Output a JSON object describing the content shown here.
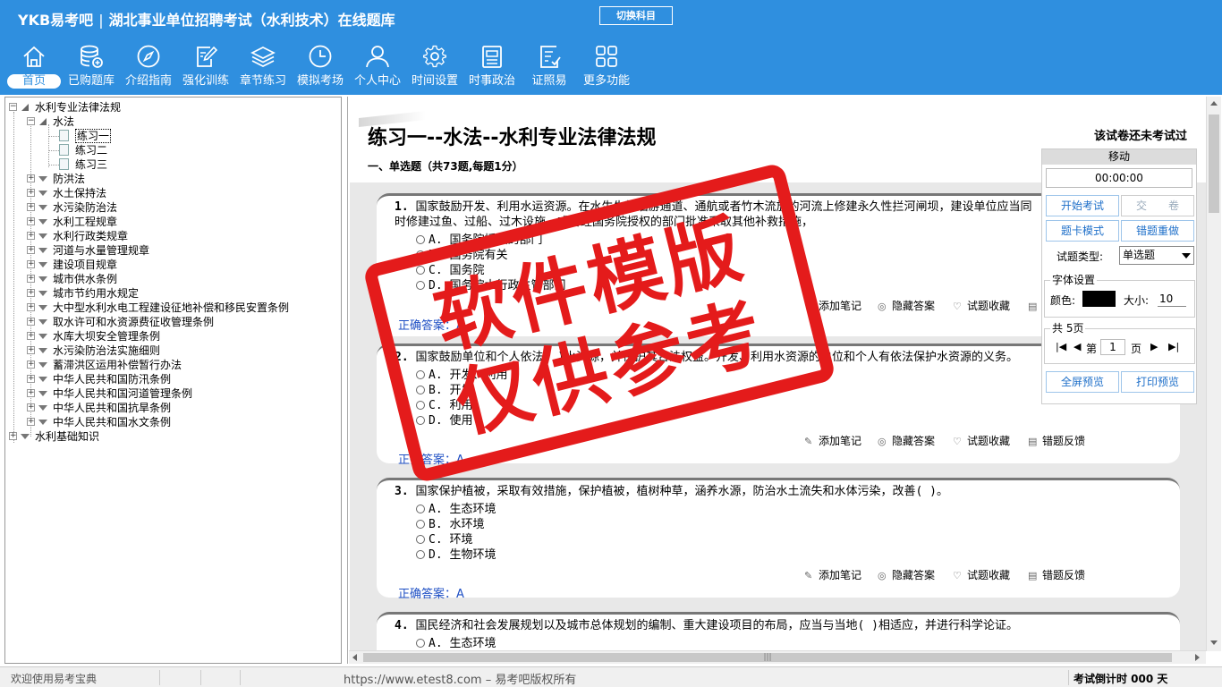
{
  "app": {
    "logo": "YKB易考吧",
    "separator": "|",
    "title": "湖北事业单位招聘考试（水利技术）在线题库",
    "switch_subject": "切换科目"
  },
  "nav": [
    {
      "label": "首页",
      "icon": "home-icon",
      "active": true
    },
    {
      "label": "已购题库",
      "icon": "database-icon"
    },
    {
      "label": "介绍指南",
      "icon": "compass-icon"
    },
    {
      "label": "强化训练",
      "icon": "edit-icon"
    },
    {
      "label": "章节练习",
      "icon": "layers-icon"
    },
    {
      "label": "模拟考场",
      "icon": "clock-icon"
    },
    {
      "label": "个人中心",
      "icon": "user-icon"
    },
    {
      "label": "时间设置",
      "icon": "gear-icon"
    },
    {
      "label": "时事政治",
      "icon": "newspaper-icon"
    },
    {
      "label": "证照易",
      "icon": "checklist-icon"
    },
    {
      "label": "更多功能",
      "icon": "grid-icon"
    }
  ],
  "tree": {
    "root": "水利专业法律法规",
    "open_child": "水法",
    "leaves": [
      "练习一",
      "练习二",
      "练习三"
    ],
    "siblings": [
      "防洪法",
      "水土保持法",
      "水污染防治法",
      "水利工程规章",
      "水利行政类规章",
      "河道与水量管理规章",
      "建设项目规章",
      "城市供水条例",
      "城市节约用水规定",
      "大中型水利水电工程建设征地补偿和移民安置条例",
      "取水许可和水资源费征收管理条例",
      "水库大坝安全管理条例",
      "水污染防治法实施细则",
      "蓄滞洪区运用补偿暂行办法",
      "中华人民共和国防汛条例",
      "中华人民共和国河道管理条例",
      "中华人民共和国抗旱条例",
      "中华人民共和国水文条例"
    ],
    "root2": "水利基础知识"
  },
  "paper": {
    "title": "练习一--水法--水利专业法律法规",
    "status": "该试卷还未考试过",
    "section": "一、单选题（共73题,每题1分）"
  },
  "tools": {
    "note": "添加笔记",
    "hide": "隐藏答案",
    "fav": "试题收藏",
    "report": "错题反馈"
  },
  "answer_label": "正确答案：",
  "questions": [
    {
      "num": "1.",
      "text": "国家鼓励开发、利用水运资源。在水生生物洄游通道、通航或者竹木流放的河流上修建永久性拦河闸坝，建设单位应当同时修建过鱼、过船、过木设施，或者经国务院授权的部门批准采取其他补救措施，",
      "options": [
        "A. 国务院授权的部门",
        "B. 国务院有关",
        "C. 国务院",
        "D. 国务院水行政主管部门"
      ],
      "answer": "A"
    },
    {
      "num": "2.",
      "text": "国家鼓励单位和个人依法( )水资源，并保护其合法权益。开发、利用水资源的单位和个人有依法保护水资源的义务。",
      "options": [
        "A. 开发、利用",
        "B. 开发",
        "C. 利用",
        "D. 使用"
      ],
      "answer": "A"
    },
    {
      "num": "3.",
      "text": "国家保护植被，采取有效措施，保护植被，植树种草，涵养水源，防治水土流失和水体污染，改善( )。",
      "options": [
        "A. 生态环境",
        "B. 水环境",
        "C. 环境",
        "D. 生物环境"
      ],
      "answer": "A"
    },
    {
      "num": "4.",
      "text": "国民经济和社会发展规划以及城市总体规划的编制、重大建设项目的布局，应当与当地( )相适应，并进行科学论证。",
      "options": [
        "A. 生态环境"
      ],
      "answer": ""
    }
  ],
  "panel": {
    "title": "移动",
    "timer": "00:00:00",
    "start": "开始考试",
    "submit": "交　　卷",
    "card_mode": "题卡模式",
    "wrong_redo": "错题重做",
    "type_label": "试题类型:",
    "type_value": "单选题",
    "font_legend": "字体设置",
    "color_label": "颜色:",
    "size_label": "大小:",
    "size_value": "10",
    "text_color": "#000000",
    "pages_legend": "共 5页",
    "page_prefix": "第",
    "page_value": "1",
    "page_suffix": "页",
    "fullscreen": "全屏预览",
    "print": "打印预览"
  },
  "status": {
    "welcome": "欢迎使用易考宝典",
    "copyright": "https://www.etest8.com – 易考吧版权所有",
    "countdown": "考试倒计时 000 天"
  },
  "watermark": {
    "line1": "软件模版",
    "line2": "仅供参考"
  },
  "colors": {
    "header_bg": "#2f8fdf",
    "stamp_red": "#e41b1b",
    "answer_blue": "#1e4fc4"
  }
}
